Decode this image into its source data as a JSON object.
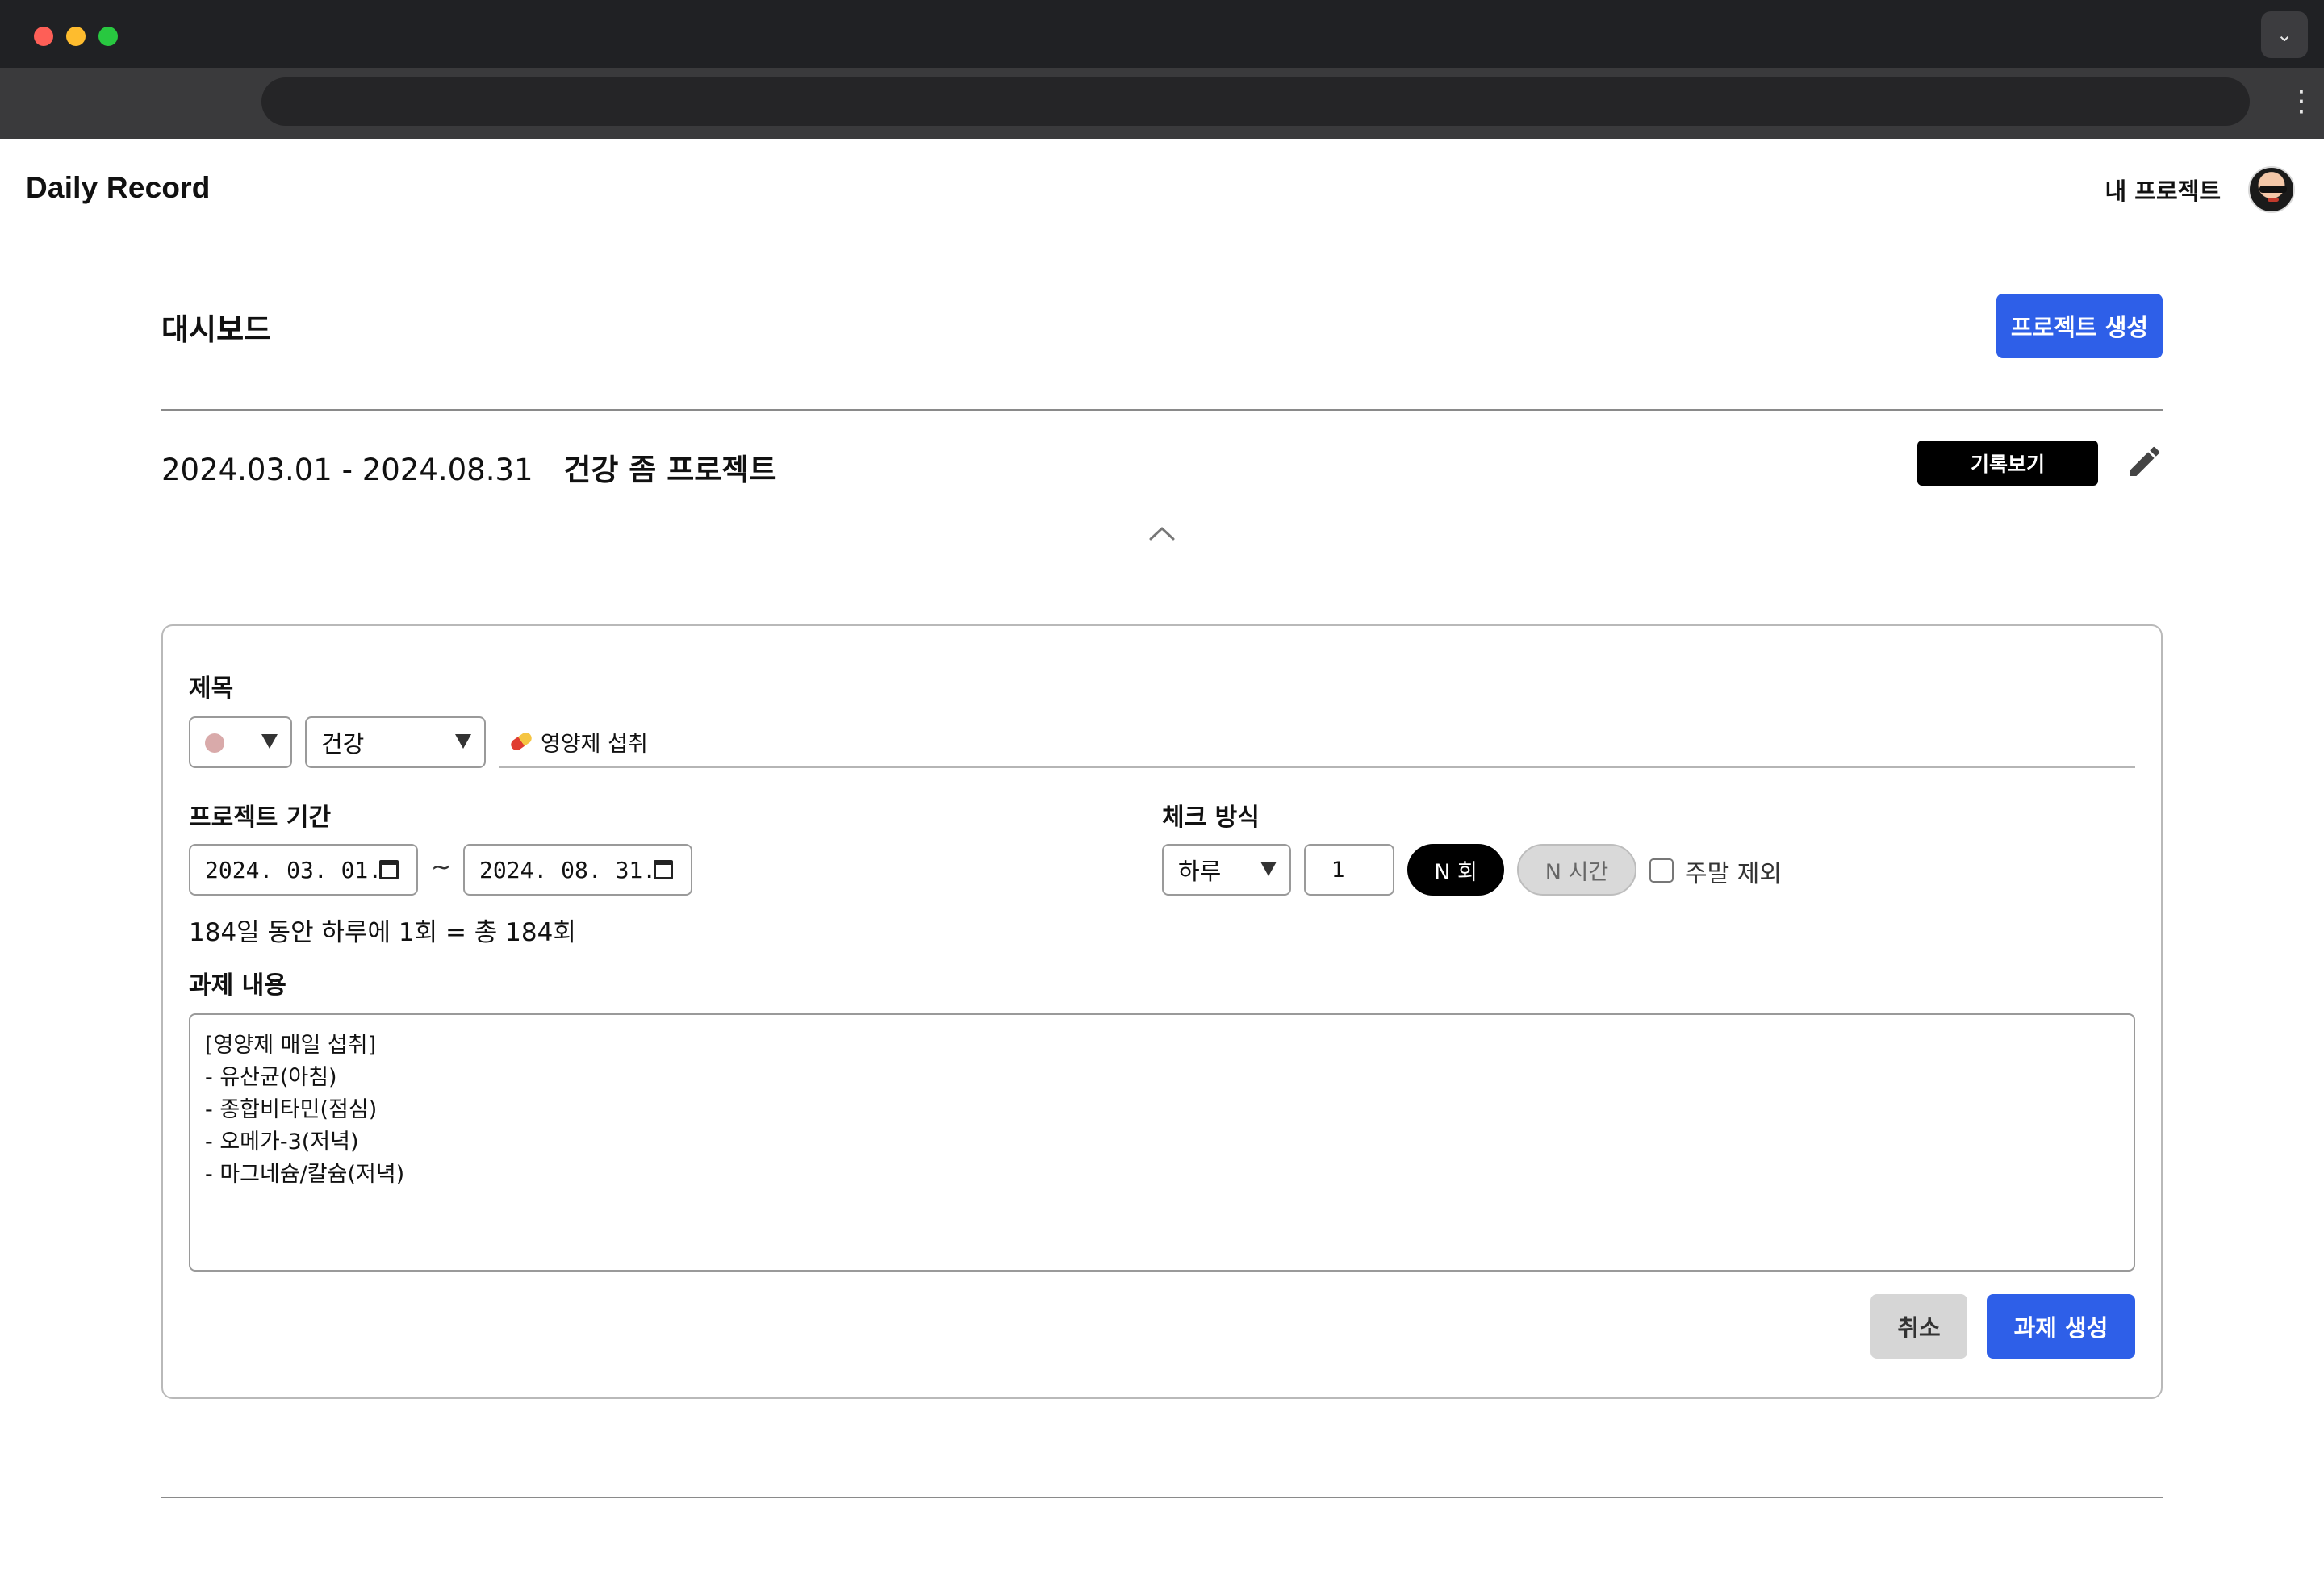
{
  "header": {
    "brand": "Daily Record",
    "my_projects": "내 프로젝트"
  },
  "dashboard": {
    "title": "대시보드",
    "create_project_label": "프로젝트 생성"
  },
  "project": {
    "period": "2024.03.01 - 2024.08.31",
    "name": "건강 좀 프로젝트",
    "records_label": "기록보기"
  },
  "form": {
    "title_label": "제목",
    "color_dot": "#d9aaaa",
    "category": "건강",
    "task_title": "영양제 섭취",
    "period_label": "프로젝트 기간",
    "start_date": "2024. 03. 01.",
    "end_date": "2024. 08. 31.",
    "separator": "~",
    "summary": "184일 동안 하루에 1회 = 총 184회",
    "check_label": "체크 방식",
    "frequency": "하루",
    "count": "1",
    "ntimes_label": "N 회",
    "nhours_label": "N 시간",
    "exclude_weekend_label": "주말 제외",
    "content_label": "과제 내용",
    "content": "[영양제 매일 섭취]\n- 유산균(아침)\n- 종합비타민(점심)\n- 오메가-3(저녁)\n- 마그네슘/칼슘(저녁)",
    "cancel_label": "취소",
    "submit_label": "과제 생성"
  },
  "colors": {
    "primary": "#2e5fe8",
    "black": "#000000",
    "muted": "#d6d6d6"
  },
  "icons": {
    "edit": "pencil-icon",
    "collapse": "chevron-up-icon",
    "calendar": "calendar-icon",
    "dropdown": "caret-down-icon",
    "title_emoji": "pill-icon"
  }
}
